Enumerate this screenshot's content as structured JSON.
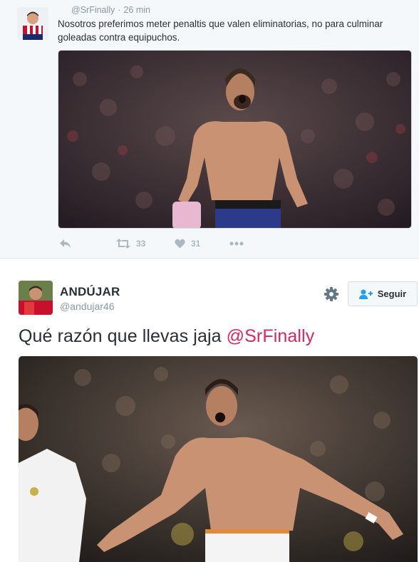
{
  "tweet1": {
    "handle": "@SrFinally",
    "separator": "·",
    "time": "26 min",
    "text": "Nosotros preferimos meter penaltis que valen eliminatorias, no para culminar goleadas contra equipuchos.",
    "photo_icon": "photo-celebrating-player-shirtless",
    "actions": {
      "reply_icon": "reply-icon",
      "retweet_icon": "retweet-icon",
      "retweet_count": "33",
      "like_icon": "heart-icon",
      "like_count": "31",
      "more_icon": "more-dots-icon"
    }
  },
  "tweet2": {
    "name": "ANDÚJAR",
    "handle": "@andujar46",
    "settings_icon": "gear-icon",
    "follow": {
      "icon": "add-user-icon",
      "label": "Seguir"
    },
    "text_prefix": "Qué razón que llevas jaja ",
    "mention": "@SrFinally",
    "photo_icon": "photo-celebrating-player-white-kit"
  },
  "colors": {
    "mention": "#e0245e",
    "action_grey": "#aab8c2",
    "follow_icon": "#1da1f2"
  }
}
